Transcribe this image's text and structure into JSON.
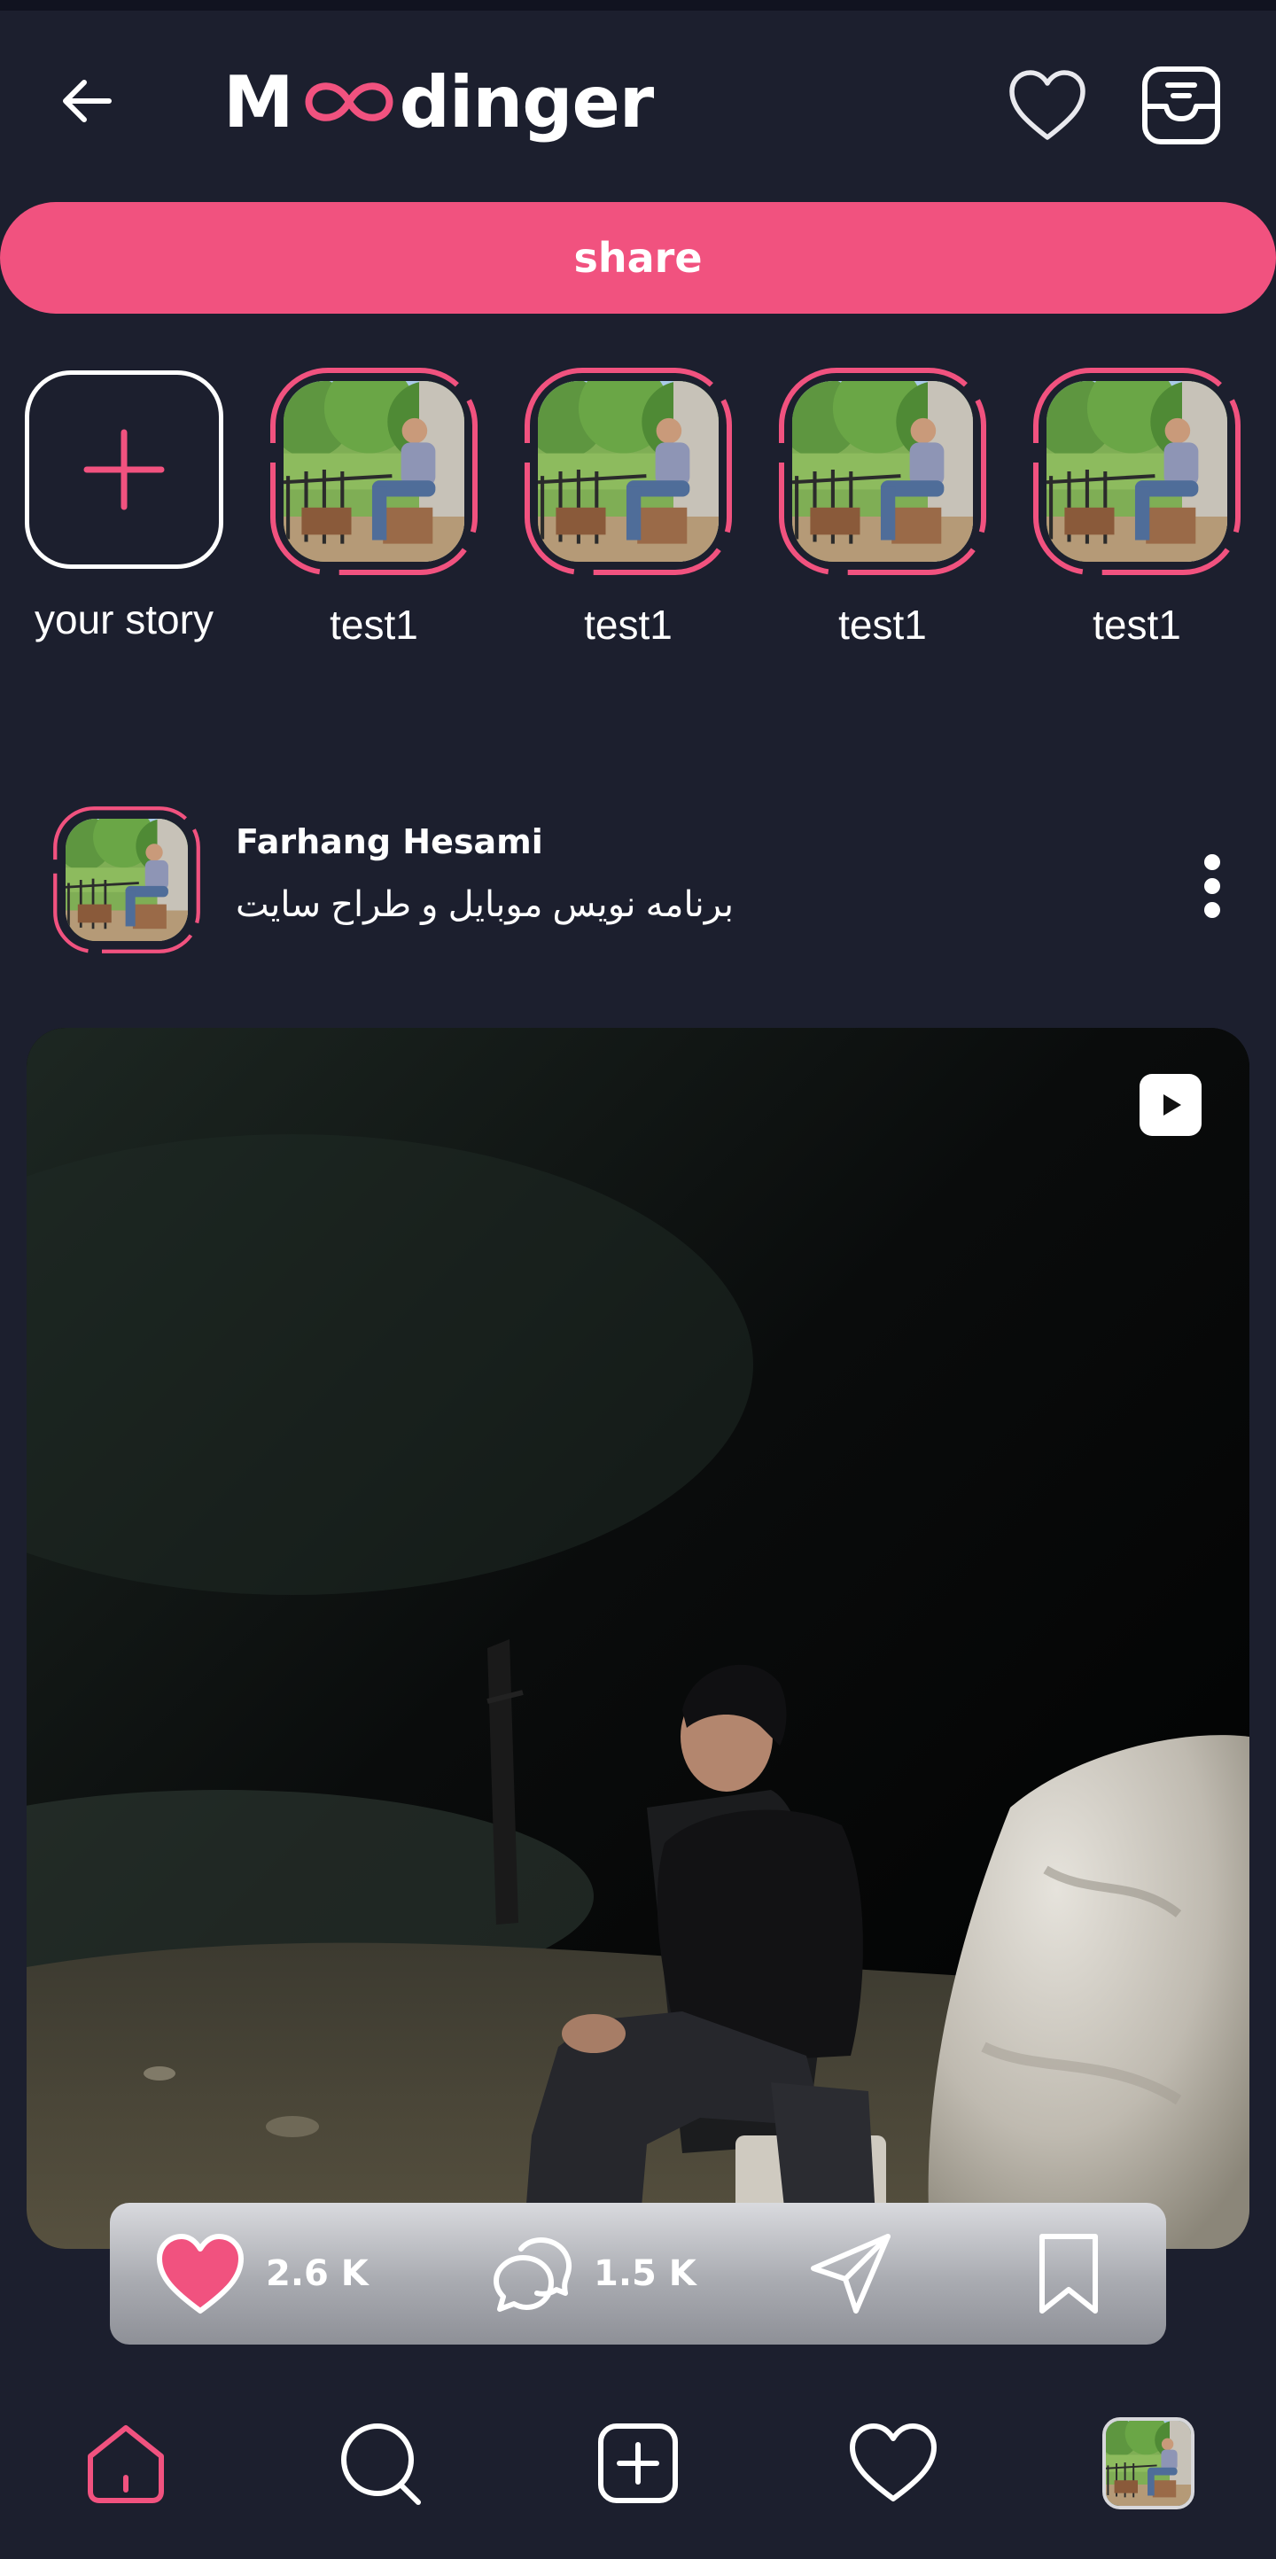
{
  "header": {
    "logo_prefix": "M",
    "logo_suffix": "dinger"
  },
  "share_button": {
    "label": "share"
  },
  "stories": {
    "add_label": "your story",
    "items": [
      {
        "label": "test1"
      },
      {
        "label": "test1"
      },
      {
        "label": "test1"
      },
      {
        "label": "test1"
      }
    ]
  },
  "post": {
    "author_name": "Farhang Hesami",
    "author_bio": "برنامه نویس موبایل و طراح سایت",
    "likes": "2.6 K",
    "comments": "1.5 K"
  },
  "colors": {
    "accent": "#f1527f",
    "background": "#1c1f2e",
    "text": "#ffffff"
  },
  "icons": {
    "back": "back-arrow-icon",
    "notifications": "heart-outline-icon",
    "inbox": "inbox-icon",
    "add_story": "plus-icon",
    "more": "more-vertical-icon",
    "video": "play-icon",
    "like": "heart-filled-icon",
    "comment": "comment-icon",
    "share": "send-icon",
    "save": "bookmark-icon",
    "nav": [
      "home-icon",
      "search-icon",
      "add-post-icon",
      "heart-icon",
      "profile-avatar"
    ]
  }
}
